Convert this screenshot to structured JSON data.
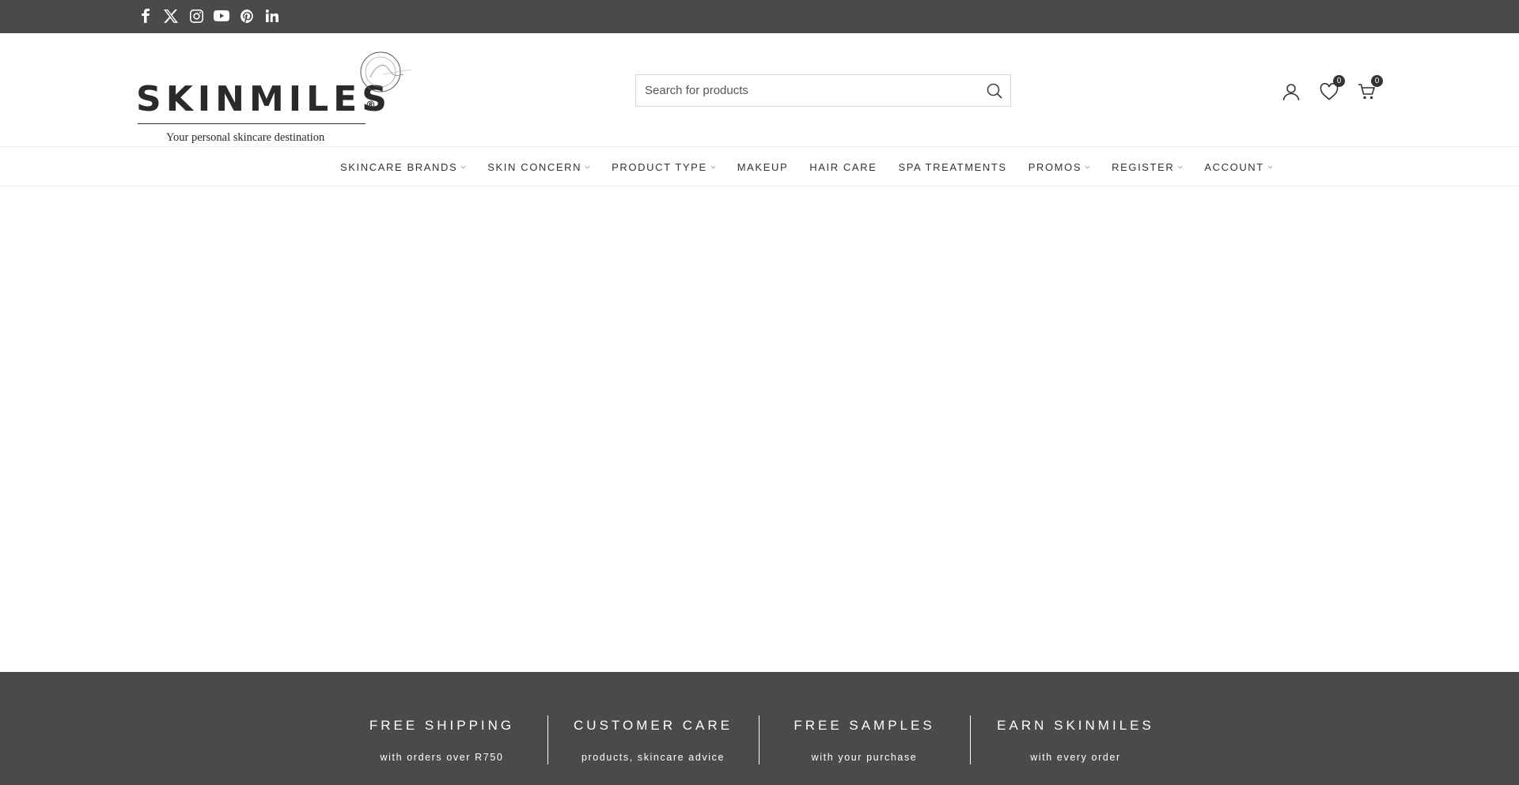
{
  "social": {
    "icons": [
      "facebook-icon",
      "x-icon",
      "instagram-icon",
      "youtube-icon",
      "pinterest-icon",
      "linkedin-icon"
    ]
  },
  "logo": {
    "wordmark": "SKINMILES",
    "registered": "®",
    "tagline": "Your personal skincare destination"
  },
  "search": {
    "placeholder": "Search for products"
  },
  "header_actions": {
    "wishlist_count": "0",
    "cart_count": "0"
  },
  "nav": {
    "items": [
      {
        "label": "SKINCARE BRANDS",
        "has_dropdown": true
      },
      {
        "label": "SKIN CONCERN",
        "has_dropdown": true
      },
      {
        "label": "PRODUCT TYPE",
        "has_dropdown": true
      },
      {
        "label": "MAKEUP",
        "has_dropdown": false
      },
      {
        "label": "HAIR CARE",
        "has_dropdown": false
      },
      {
        "label": "SPA TREATMENTS",
        "has_dropdown": false
      },
      {
        "label": "PROMOS",
        "has_dropdown": true
      },
      {
        "label": "REGISTER",
        "has_dropdown": true
      },
      {
        "label": "ACCOUNT",
        "has_dropdown": true
      }
    ]
  },
  "features": [
    {
      "title": "FREE SHIPPING",
      "subtitle": "with orders over R750"
    },
    {
      "title": "CUSTOMER CARE",
      "subtitle": "products, skincare advice"
    },
    {
      "title": "FREE SAMPLES",
      "subtitle": "with your purchase"
    },
    {
      "title": "EARN SKINMILES",
      "subtitle": "with every order"
    }
  ],
  "colors": {
    "topbar": "#4a4a4a",
    "footer_band": "#4a4a4a",
    "text": "#333333"
  }
}
